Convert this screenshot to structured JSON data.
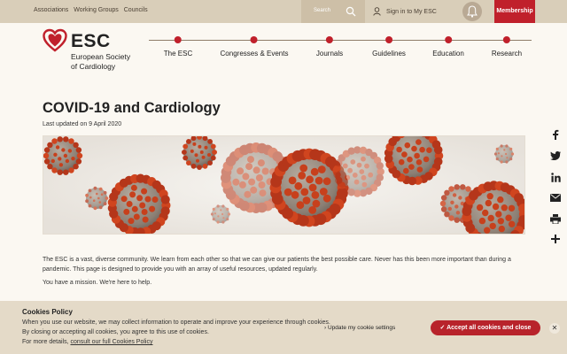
{
  "topbar": {
    "links": [
      "Associations",
      "Working Groups",
      "Councils"
    ],
    "search_label": "Search",
    "signin_label": "Sign in to My ESC",
    "membership_label": "Membership"
  },
  "logo": {
    "short": "ESC",
    "line1": "European Society",
    "line2": "of Cardiology"
  },
  "nav": {
    "items": [
      "The ESC",
      "Congresses & Events",
      "Journals",
      "Guidelines",
      "Education",
      "Research"
    ]
  },
  "page": {
    "title": "COVID-19 and Cardiology",
    "updated": "Last updated on 9 April 2020",
    "para1": "The ESC is a vast, diverse community. We learn from each other so that we can give our patients the best possible care. Never has this been more important than during a pandemic. This page is designed to provide you with an array of useful resources, updated regularly.",
    "para2": "You have a mission. We're here to help."
  },
  "social": {
    "icons": [
      "facebook-icon",
      "twitter-icon",
      "linkedin-icon",
      "email-icon",
      "print-icon",
      "plus-icon"
    ]
  },
  "cookie": {
    "heading": "Cookies Policy",
    "line1": "When you use our website, we may collect information to operate and improve your experience through cookies.",
    "line2": "By closing or accepting all cookies, you agree to this use of cookies.",
    "line3_prefix": "For more details,",
    "line3_link": "consult our full Cookies Policy",
    "manage_label": "Update my cookie settings",
    "accept_label": "Accept all cookies and close"
  },
  "colors": {
    "brand_red": "#c0202b",
    "topbar": "#d9ceb9",
    "cookie_bg": "#e4dac8"
  }
}
